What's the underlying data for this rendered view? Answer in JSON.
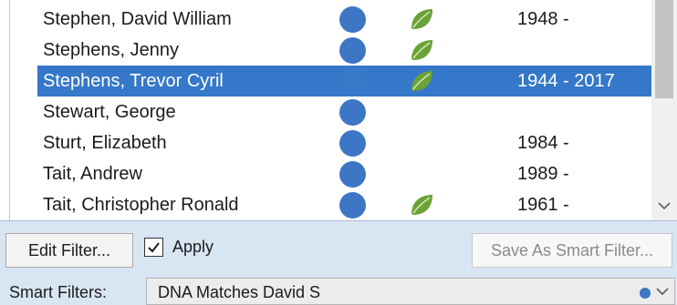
{
  "people_list": {
    "rows": [
      {
        "name": "Stephen, David William",
        "years": "1948 -",
        "has_blue_dot": true,
        "has_leaf": true,
        "selected": false
      },
      {
        "name": "Stephens, Jenny",
        "years": "",
        "has_blue_dot": true,
        "has_leaf": true,
        "selected": false
      },
      {
        "name": "Stephens, Trevor Cyril",
        "years": "1944 - 2017",
        "has_blue_dot": true,
        "has_leaf": true,
        "selected": true
      },
      {
        "name": "Stewart, George",
        "years": "",
        "has_blue_dot": true,
        "has_leaf": false,
        "selected": false
      },
      {
        "name": "Sturt, Elizabeth",
        "years": "1984 -",
        "has_blue_dot": true,
        "has_leaf": false,
        "selected": false
      },
      {
        "name": "Tait, Andrew",
        "years": "1989 -",
        "has_blue_dot": true,
        "has_leaf": false,
        "selected": false
      },
      {
        "name": "Tait, Christopher Ronald",
        "years": "1961 -",
        "has_blue_dot": true,
        "has_leaf": true,
        "selected": false
      }
    ],
    "icons": {
      "status": "blue-dot-icon",
      "hint": "green-leaf-icon"
    }
  },
  "filter_bar": {
    "edit_filter_label": "Edit Filter...",
    "apply_label": "Apply",
    "apply_checked": true,
    "save_smart_filter_label": "Save As Smart Filter...",
    "save_smart_filter_enabled": false
  },
  "smart_filters": {
    "label": "Smart Filters:",
    "selected_value": "DNA Matches David S"
  },
  "colors": {
    "selection": "#3577c9",
    "dot": "#3e76c6",
    "leaf": "#6aa236",
    "filter_bar_bg": "#d8e5f3"
  }
}
